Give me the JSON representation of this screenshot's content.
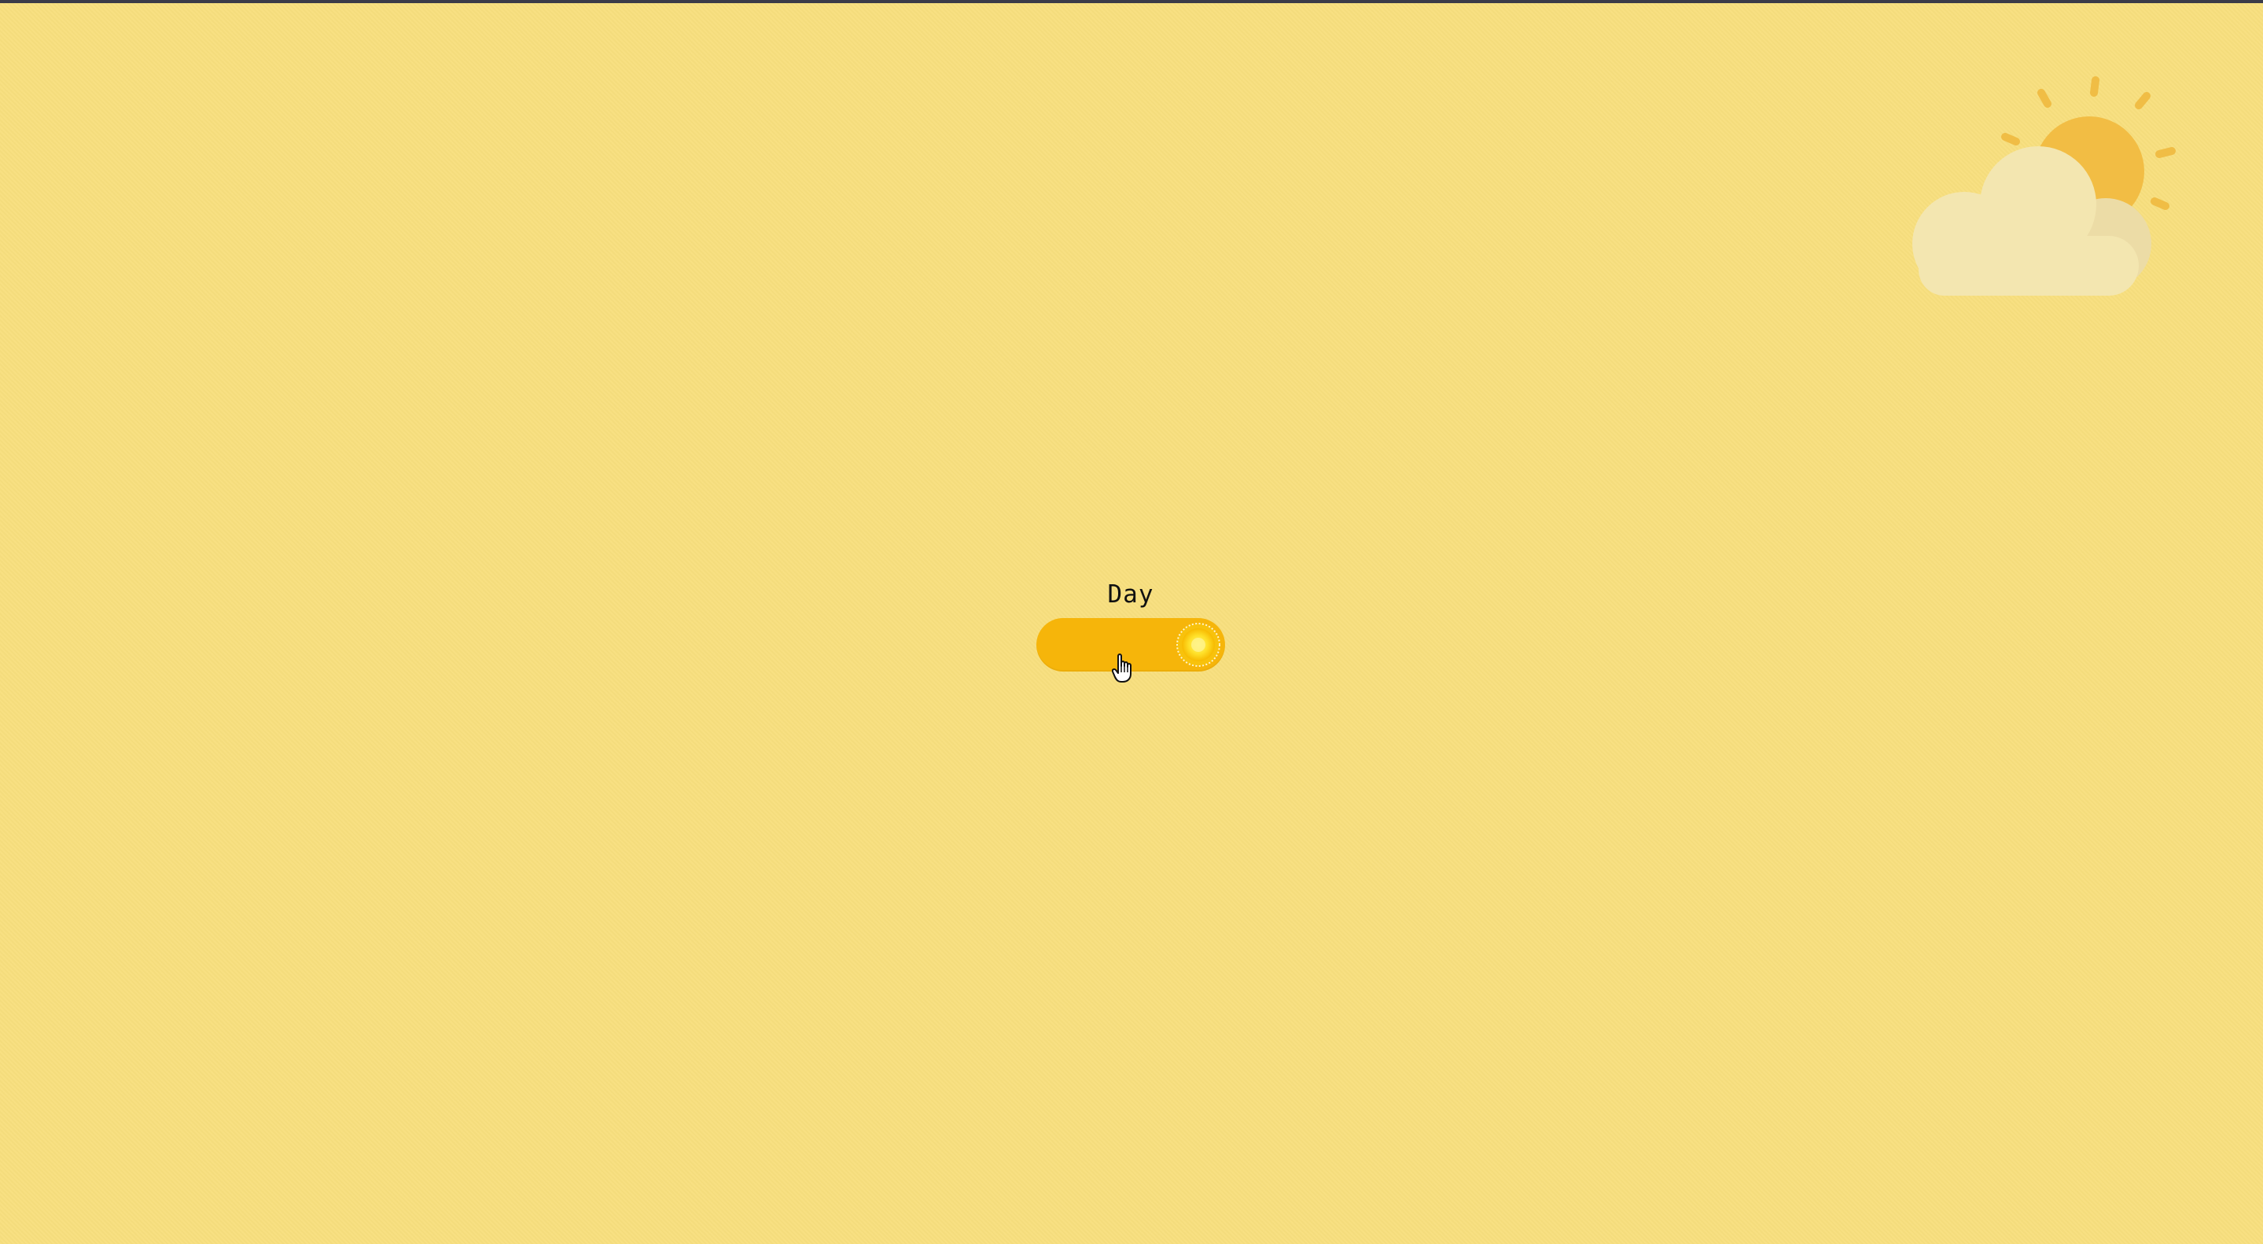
{
  "toggle": {
    "label": "Day",
    "state": "on",
    "track_color": "#f6b50a",
    "knob_icon": "sun-icon"
  },
  "decoration": {
    "icon": "partly-cloudy-icon",
    "sun_color": "#f2bd44",
    "cloud_color": "#f3e6b0"
  },
  "colors": {
    "background": "#f8df7e",
    "window_border": "#3b3b48"
  }
}
